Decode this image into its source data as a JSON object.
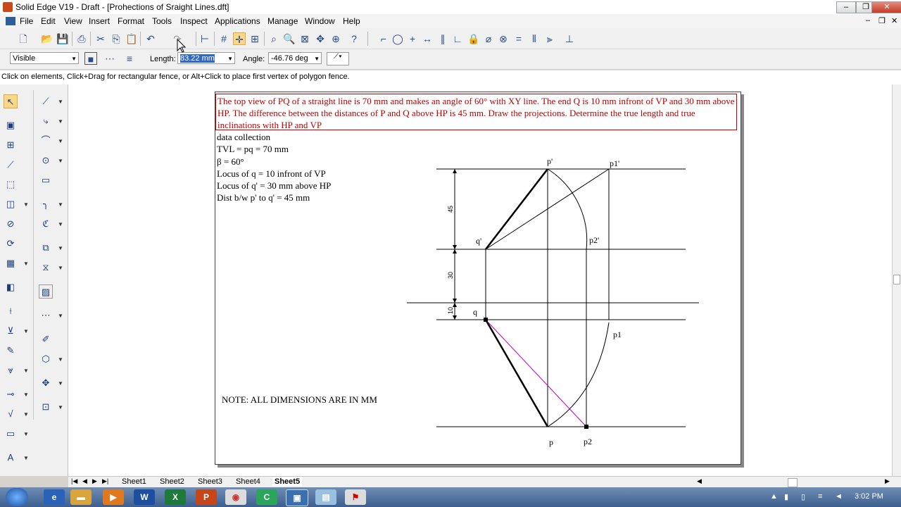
{
  "window": {
    "title": "Solid Edge V19 - Draft - [Prohections of Sraight Lines.dft]"
  },
  "menu": [
    "File",
    "Edit",
    "View",
    "Insert",
    "Format",
    "Tools",
    "Inspect",
    "Applications",
    "Manage",
    "Window",
    "Help"
  ],
  "ribbon": {
    "style_value": "Visible",
    "length_label": "Length:",
    "length_value": "83.22 mm",
    "angle_label": "Angle:",
    "angle_value": "-46.76 deg"
  },
  "status": {
    "prompt": "Click on elements, Click+Drag for rectangular fence, or Alt+Click to place first vertex of polygon fence."
  },
  "sheet": {
    "problem_text": "The top view of PQ of a straight line is 70 mm and makes an angle of 60° with XY line. The end Q is 10 mm infront of VP and 30 mm above HP. The difference between the distances of P and Q above HP is 45 mm. Draw the projections. Determine the true length and true inclinations with HP and VP",
    "data_lines": [
      "data collection",
      "TVL = pq = 70 mm",
      "β = 60°",
      "Locus of q = 10 infront of VP",
      "Locus of q' = 30 mm above HP",
      "Dist b/w p' to q' = 45 mm"
    ],
    "note": "NOTE: ALL DIMENSIONS ARE IN MM",
    "labels": {
      "p_dash": "p'",
      "p1_dash": "p1'",
      "q_dash": "q'",
      "p2_dash": "p2'",
      "q": "q",
      "p1": "p1",
      "p": "p",
      "p2": "p2"
    },
    "dims": {
      "d45": "45",
      "d30": "30",
      "d10": "10"
    }
  },
  "sheet_tabs": [
    "Sheet1",
    "Sheet2",
    "Sheet3",
    "Sheet4",
    "Sheet5"
  ],
  "active_sheet": "Sheet5",
  "taskbar": {
    "time": "3:02 PM",
    "apps": [
      "W",
      "X",
      "P"
    ]
  },
  "colors": {
    "problem_red": "#c00000",
    "magenta_line": "#c000c0",
    "selected_tool": "#fbd889"
  }
}
